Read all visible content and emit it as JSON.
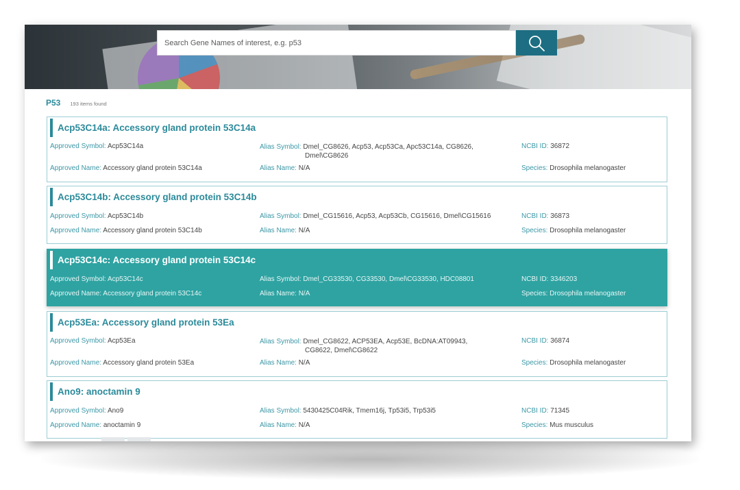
{
  "search": {
    "placeholder": "Search Gene Names of interest, e.g. p53"
  },
  "results": {
    "query": "P53",
    "count_text": "193 items found"
  },
  "labels": {
    "approved_symbol": "Approved Symbol:",
    "approved_name": "Approved Name:",
    "alias_symbol": "Alias Symbol:",
    "alias_name": "Alias Name:",
    "ncbi_id": "NCBI ID:",
    "species": "Species:"
  },
  "cards": [
    {
      "title": "Acp53C14a: Accessory gland protein 53C14a",
      "approved_symbol": "Acp53C14a",
      "approved_name": "Accessory gland protein 53C14a",
      "alias_symbol_line1": "Dmel_CG8626, Acp53, Acp53Ca, Apc53C14a, CG8626,",
      "alias_symbol_line2": "Dmel\\CG8626",
      "alias_name": "N/A",
      "ncbi_id": "36872",
      "species": "Drosophila melanogaster"
    },
    {
      "title": "Acp53C14b: Accessory gland protein 53C14b",
      "approved_symbol": "Acp53C14b",
      "approved_name": "Accessory gland protein 53C14b",
      "alias_symbol_line1": "Dmel_CG15616, Acp53, Acp53Cb, CG15616, Dmel\\CG15616",
      "alias_name": "N/A",
      "ncbi_id": "36873",
      "species": "Drosophila melanogaster"
    },
    {
      "title": "Acp53C14c: Accessory gland protein 53C14c",
      "approved_symbol": "Acp53C14c",
      "approved_name": "Accessory gland protein 53C14c",
      "alias_symbol_line1": "Dmel_CG33530, CG33530, Dmel\\CG33530, HDC08801",
      "alias_name": "N/A",
      "ncbi_id": "3346203",
      "species": "Drosophila melanogaster"
    },
    {
      "title": "Acp53Ea: Accessory gland protein 53Ea",
      "approved_symbol": "Acp53Ea",
      "approved_name": "Accessory gland protein 53Ea",
      "alias_symbol_line1": "Dmel_CG8622, ACP53EA, Acp53E, BcDNA:AT09943,",
      "alias_symbol_line2": "CG8622, Dmel\\CG8622",
      "alias_name": "N/A",
      "ncbi_id": "36874",
      "species": "Drosophila melanogaster"
    },
    {
      "title": "Ano9: anoctamin 9",
      "approved_symbol": "Ano9",
      "approved_name": "anoctamin 9",
      "alias_symbol_line1": "5430425C04Rik, Tmem16j, Tp53i5, Trp53i5",
      "alias_name": "N/A",
      "ncbi_id": "71345",
      "species": "Mus musculus"
    }
  ]
}
